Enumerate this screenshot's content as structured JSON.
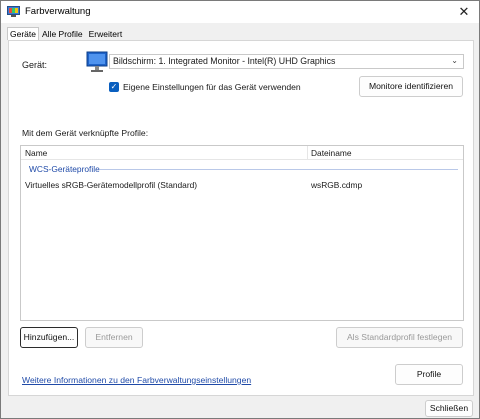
{
  "window": {
    "title": "Farbverwaltung",
    "close_glyph": "✕"
  },
  "tabs": [
    {
      "label": "Geräte",
      "active": true
    },
    {
      "label": "Alle Profile",
      "active": false
    },
    {
      "label": "Erweitert",
      "active": false
    }
  ],
  "device": {
    "label": "Gerät:",
    "selected": "Bildschirm: 1. Integrated Monitor - Intel(R) UHD Graphics",
    "icon": "monitor-icon"
  },
  "own_settings": {
    "label": "Eigene Einstellungen für das Gerät verwenden",
    "checked": true
  },
  "identify_button": "Monitore identifizieren",
  "profiles": {
    "heading": "Mit dem Gerät verknüpfte Profile:",
    "columns": {
      "name": "Name",
      "file": "Dateiname"
    },
    "group": "WCS-Geräteprofile",
    "rows": [
      {
        "name": "Virtuelles sRGB-Gerätemodellprofil (Standard)",
        "file": "wsRGB.cdmp"
      }
    ]
  },
  "buttons": {
    "add": "Hinzufügen...",
    "remove": "Entfernen",
    "set_default": "Als Standardprofil festlegen",
    "profiles": "Profile",
    "close": "Schließen"
  },
  "info_link": "Weitere Informationen zu den Farbverwaltungseinstellungen",
  "colors": {
    "accent": "#0a5fbf",
    "link": "#1f4aa8"
  }
}
